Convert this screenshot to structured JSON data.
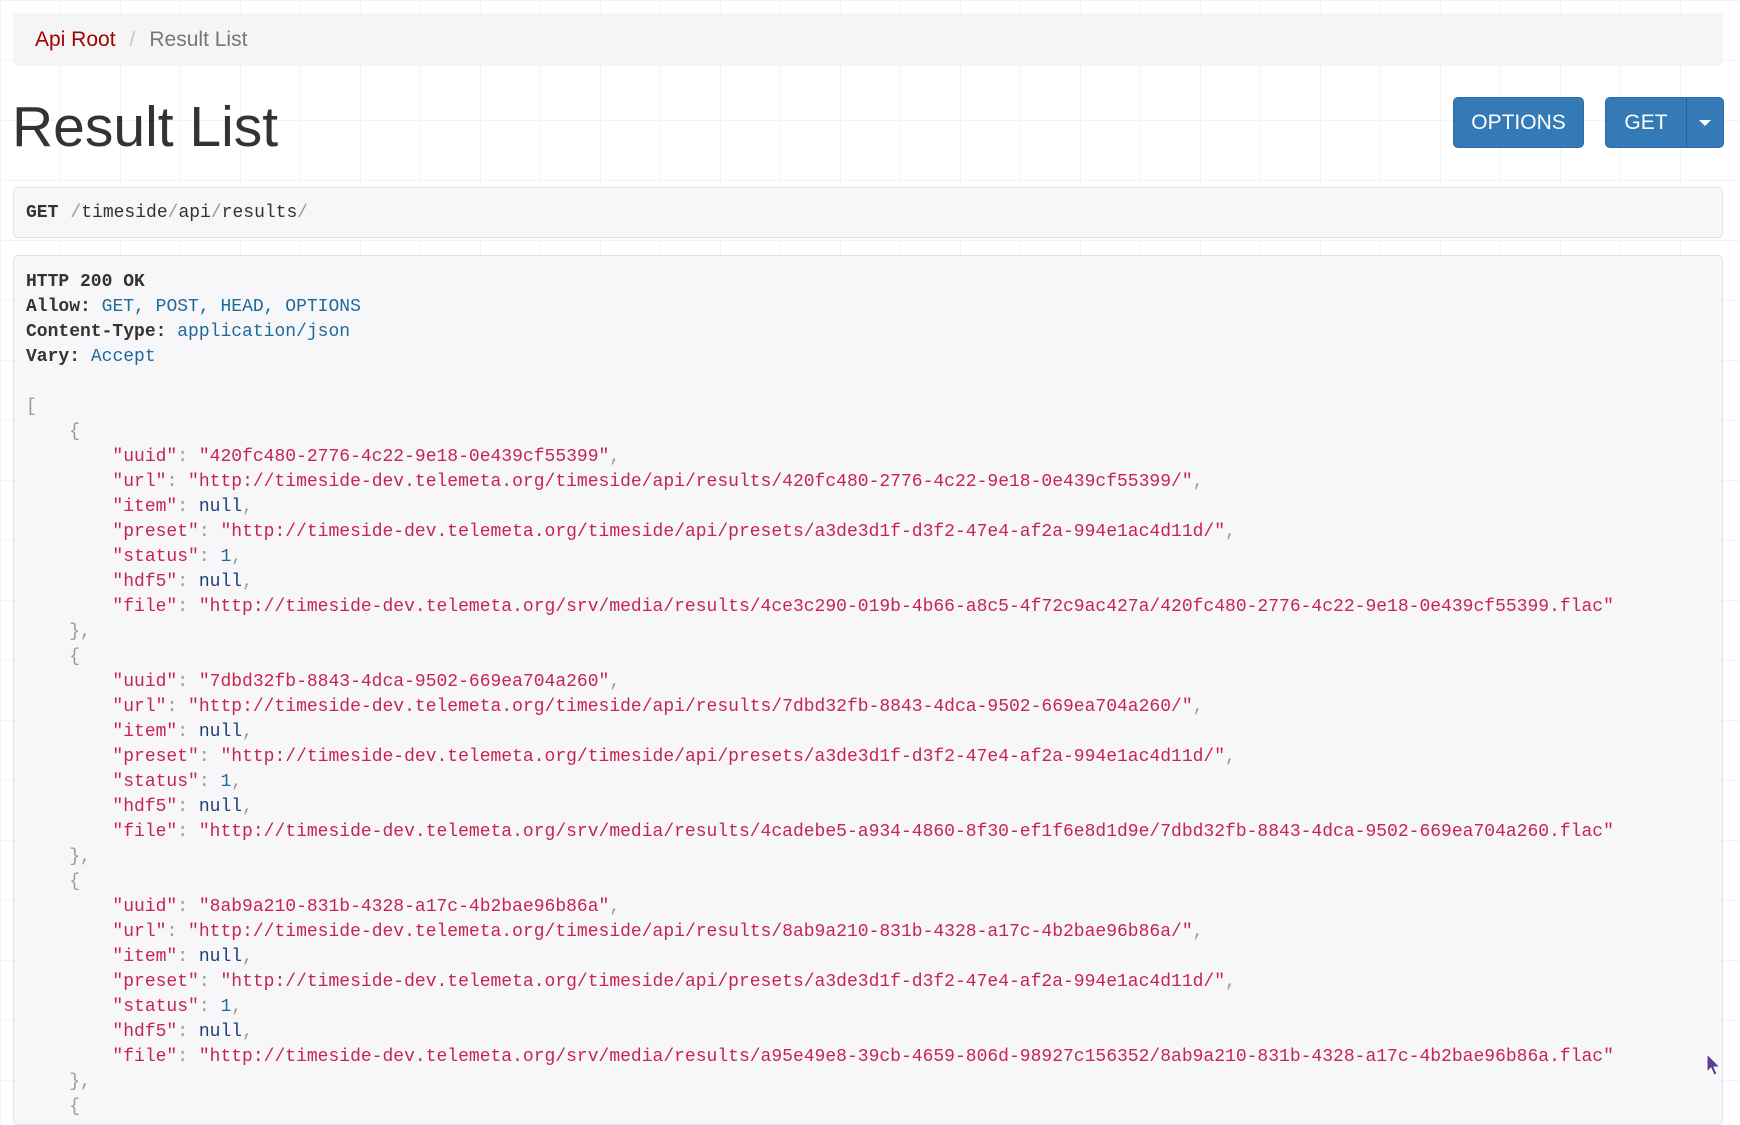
{
  "breadcrumb": {
    "root": "Api Root",
    "separator": "/",
    "current": "Result List"
  },
  "page_title": "Result List",
  "buttons": {
    "options": "OPTIONS",
    "get": "GET"
  },
  "request": {
    "method": "GET",
    "path": [
      "timeside",
      "api",
      "results"
    ]
  },
  "response": {
    "status": "HTTP 200 OK",
    "headers": [
      {
        "name": "Allow",
        "value": "GET, POST, HEAD, OPTIONS"
      },
      {
        "name": "Content-Type",
        "value": "application/json"
      },
      {
        "name": "Vary",
        "value": "Accept"
      }
    ],
    "results": [
      {
        "uuid": "420fc480-2776-4c22-9e18-0e439cf55399",
        "url": "http://timeside-dev.telemeta.org/timeside/api/results/420fc480-2776-4c22-9e18-0e439cf55399/",
        "item": "null",
        "preset": "http://timeside-dev.telemeta.org/timeside/api/presets/a3de3d1f-d3f2-47e4-af2a-994e1ac4d11d/",
        "status": "1",
        "hdf5": "null",
        "file": "http://timeside-dev.telemeta.org/srv/media/results/4ce3c290-019b-4b66-a8c5-4f72c9ac427a/420fc480-2776-4c22-9e18-0e439cf55399.flac"
      },
      {
        "uuid": "7dbd32fb-8843-4dca-9502-669ea704a260",
        "url": "http://timeside-dev.telemeta.org/timeside/api/results/7dbd32fb-8843-4dca-9502-669ea704a260/",
        "item": "null",
        "preset": "http://timeside-dev.telemeta.org/timeside/api/presets/a3de3d1f-d3f2-47e4-af2a-994e1ac4d11d/",
        "status": "1",
        "hdf5": "null",
        "file": "http://timeside-dev.telemeta.org/srv/media/results/4cadebe5-a934-4860-8f30-ef1f6e8d1d9e/7dbd32fb-8843-4dca-9502-669ea704a260.flac"
      },
      {
        "uuid": "8ab9a210-831b-4328-a17c-4b2bae96b86a",
        "url": "http://timeside-dev.telemeta.org/timeside/api/results/8ab9a210-831b-4328-a17c-4b2bae96b86a/",
        "item": "null",
        "preset": "http://timeside-dev.telemeta.org/timeside/api/presets/a3de3d1f-d3f2-47e4-af2a-994e1ac4d11d/",
        "status": "1",
        "hdf5": "null",
        "file": "http://timeside-dev.telemeta.org/srv/media/results/a95e49e8-39cb-4659-806d-98927c156352/8ab9a210-831b-4328-a17c-4b2bae96b86a.flac"
      }
    ]
  },
  "colors": {
    "primary": "#337ab7",
    "link": "#a30000",
    "json_string": "#c7254e"
  }
}
